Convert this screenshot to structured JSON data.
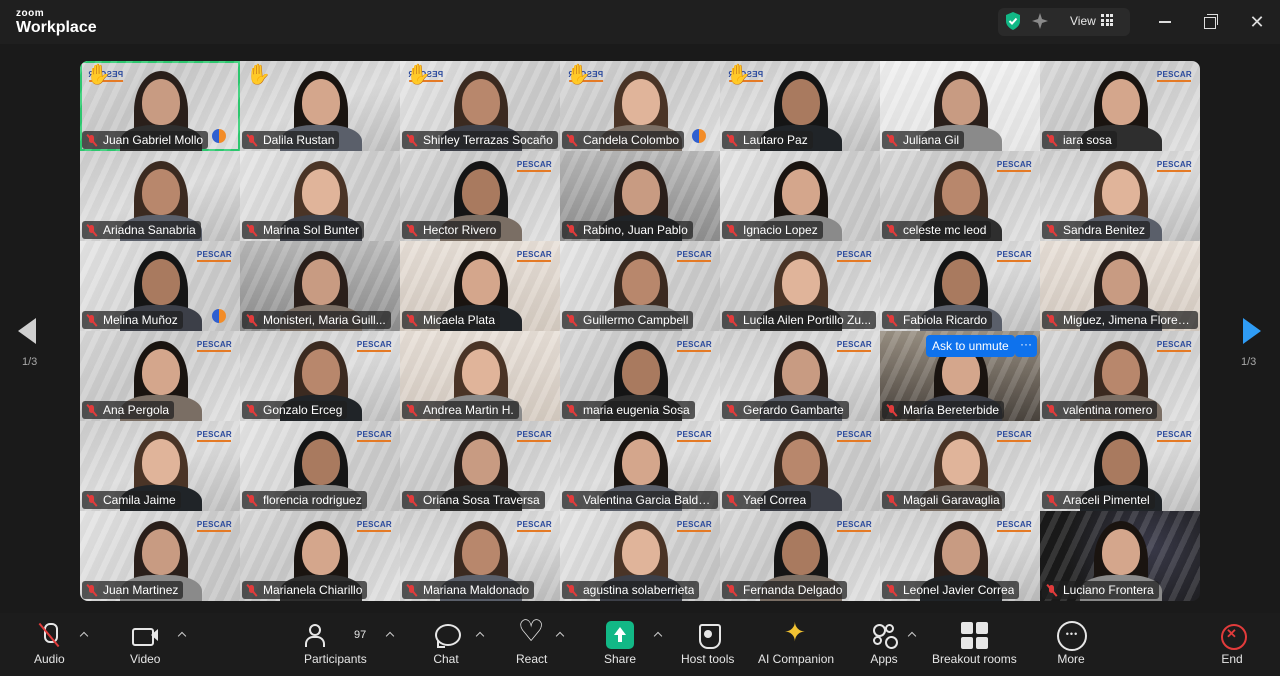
{
  "app": {
    "brand_top": "zoom",
    "brand_bottom": "Workplace",
    "view_label": "View"
  },
  "colors": {
    "accent": "#0e72ed",
    "share_green": "#12b886",
    "end_red": "#e23b3b",
    "active_outline": "#2ecc71",
    "ai_gold": "#f1c232"
  },
  "pagination": {
    "current": "1/3"
  },
  "participants": [
    {
      "name": "Juan Gabriel Mollo",
      "hand": "✋",
      "pescar": "PESCAR",
      "speaker": true,
      "active": true
    },
    {
      "name": "Dalila Rustan",
      "hand": "✋"
    },
    {
      "name": "Shirley Terrazas Socaño",
      "hand": "✋",
      "pescar": "PESCAR"
    },
    {
      "name": "Candela Colombo",
      "hand": "✋",
      "pescar": "PESCAR",
      "speaker": true
    },
    {
      "name": "Lautaro Paz",
      "hand": "✋",
      "pescar": "PESCAR"
    },
    {
      "name": "Juliana Gil"
    },
    {
      "name": "iara sosa",
      "pescar": "PESCAR"
    },
    {
      "name": "Ariadna Sanabria"
    },
    {
      "name": "Marina Sol Bunter"
    },
    {
      "name": "Hector Rivero",
      "pescar": "PESCAR"
    },
    {
      "name": "Rabino, Juan Pablo"
    },
    {
      "name": "Ignacio Lopez"
    },
    {
      "name": "celeste mc leod",
      "pescar": "PESCAR"
    },
    {
      "name": "Sandra Benitez",
      "pescar": "PESCAR"
    },
    {
      "name": "Melina Muñoz",
      "pescar": "PESCAR",
      "speaker": true
    },
    {
      "name": "Monisteri, Maria Guill..."
    },
    {
      "name": "Micaela Plata",
      "pescar": "PESCAR"
    },
    {
      "name": "Guillermo Campbell",
      "pescar": "PESCAR"
    },
    {
      "name": "Lucila Ailen Portillo Zu...",
      "pescar": "PESCAR"
    },
    {
      "name": "Fabiola Ricardo",
      "pescar": "PESCAR"
    },
    {
      "name": "Miguez, Jimena Floren..."
    },
    {
      "name": "Ana Pergola",
      "pescar": "PESCAR"
    },
    {
      "name": "Gonzalo Erceg",
      "pescar": "PESCAR"
    },
    {
      "name": "Andrea Martin H."
    },
    {
      "name": "maria eugenia Sosa",
      "pescar": "PESCAR"
    },
    {
      "name": "Gerardo Gambarte",
      "pescar": "PESCAR"
    },
    {
      "name": "María Bereterbide",
      "unmute_label": "Ask to unmute",
      "more_label": "···"
    },
    {
      "name": "valentina romero",
      "pescar": "PESCAR"
    },
    {
      "name": "Camila Jaime",
      "pescar": "PESCAR"
    },
    {
      "name": "florencia rodriguez",
      "pescar": "PESCAR"
    },
    {
      "name": "Oriana Sosa Traversa",
      "pescar": "PESCAR"
    },
    {
      "name": "Valentina Garcia Baldo...",
      "pescar": "PESCAR"
    },
    {
      "name": "Yael Correa",
      "pescar": "PESCAR"
    },
    {
      "name": "Magali Garavaglia",
      "pescar": "PESCAR"
    },
    {
      "name": "Araceli Pimentel",
      "pescar": "PESCAR"
    },
    {
      "name": "Juan Martinez",
      "pescar": "PESCAR"
    },
    {
      "name": "Marianela Chiarillo",
      "pescar": "PESCAR"
    },
    {
      "name": "Mariana Maldonado",
      "pescar": "PESCAR"
    },
    {
      "name": "agustina solaberrieta",
      "pescar": "PESCAR"
    },
    {
      "name": "Fernanda Delgado",
      "pescar": "PESCAR"
    },
    {
      "name": "Leonel Javier Correa",
      "pescar": "PESCAR"
    },
    {
      "name": "Luciano Frontera"
    }
  ],
  "toolbar": {
    "audio": "Audio",
    "video": "Video",
    "participants": "Participants",
    "participants_count": "97",
    "chat": "Chat",
    "react": "React",
    "share": "Share",
    "host_tools": "Host tools",
    "ai_companion": "AI Companion",
    "apps": "Apps",
    "breakout_rooms": "Breakout rooms",
    "more": "More",
    "end": "End"
  }
}
